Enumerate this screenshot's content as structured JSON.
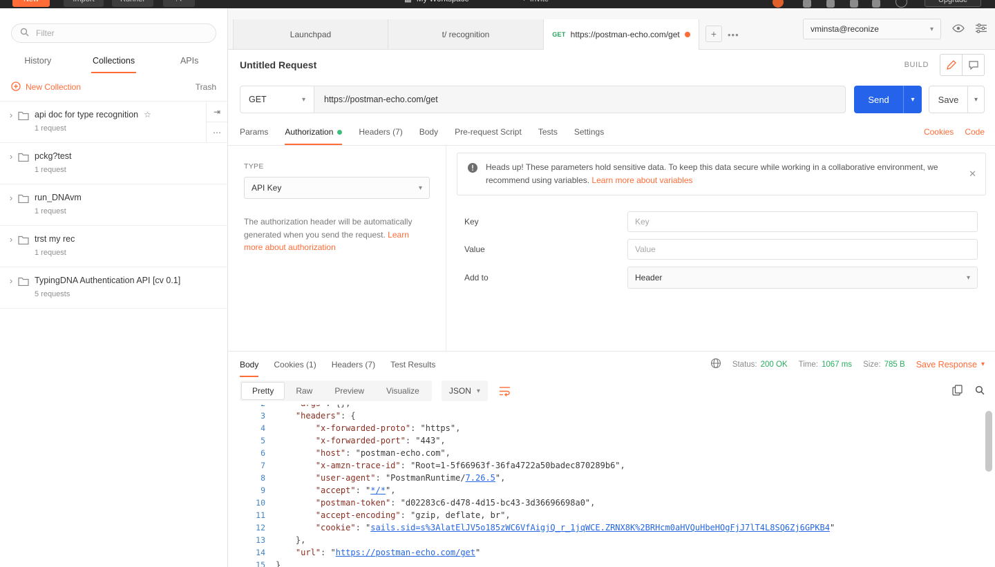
{
  "topbar": {
    "new_label": "New",
    "import_label": "Import",
    "runner_label": "Runner",
    "workspace_label": "My Workspace",
    "invite_label": "Invite",
    "upgrade_label": "Upgrade"
  },
  "sidebar": {
    "filter_placeholder": "Filter",
    "tabs": [
      {
        "label": "History",
        "active": false
      },
      {
        "label": "Collections",
        "active": true
      },
      {
        "label": "APIs",
        "active": false
      }
    ],
    "new_collection_label": "New Collection",
    "trash_label": "Trash",
    "collections": [
      {
        "name": "api doc for type recognition",
        "meta": "1 request",
        "starred": true,
        "selected": true
      },
      {
        "name": "pckg?test",
        "meta": "1 request",
        "starred": false,
        "selected": false
      },
      {
        "name": "run_DNAvm",
        "meta": "1 request",
        "starred": false,
        "selected": false
      },
      {
        "name": "trst my rec",
        "meta": "1 request",
        "starred": false,
        "selected": false
      },
      {
        "name": "TypingDNA Authentication API [cv 0.1]",
        "meta": "5 requests",
        "starred": false,
        "selected": false
      }
    ]
  },
  "tabstrip": {
    "tabs": [
      {
        "label": "Launchpad",
        "method": "",
        "active": false,
        "dirty": false
      },
      {
        "label": "t/ recognition",
        "method": "",
        "active": false,
        "dirty": false
      },
      {
        "label": "https://postman-echo.com/get",
        "method": "GET",
        "active": true,
        "dirty": true
      }
    ],
    "account": "vminsta@reconize"
  },
  "request": {
    "title": "Untitled Request",
    "build_label": "BUILD",
    "method": "GET",
    "url": "https://postman-echo.com/get",
    "send_label": "Send",
    "save_label": "Save",
    "tabs": [
      {
        "label": "Params",
        "active": false,
        "dot": false,
        "count": ""
      },
      {
        "label": "Authorization",
        "active": true,
        "dot": true,
        "count": ""
      },
      {
        "label": "Headers",
        "active": false,
        "dot": false,
        "count": "(7)"
      },
      {
        "label": "Body",
        "active": false,
        "dot": false,
        "count": ""
      },
      {
        "label": "Pre-request Script",
        "active": false,
        "dot": false,
        "count": ""
      },
      {
        "label": "Tests",
        "active": false,
        "dot": false,
        "count": ""
      },
      {
        "label": "Settings",
        "active": false,
        "dot": false,
        "count": ""
      }
    ],
    "cookies_label": "Cookies",
    "code_label": "Code"
  },
  "auth": {
    "type_label": "TYPE",
    "type_value": "API Key",
    "description": "The authorization header will be automatically generated when you send the request.",
    "learn_link": "Learn more about authorization",
    "warning_text": "Heads up! These parameters hold sensitive data. To keep this data secure while working in a collaborative environment, we recommend using variables.",
    "warning_link": "Learn more about variables",
    "key_label": "Key",
    "key_placeholder": "Key",
    "value_label": "Value",
    "value_placeholder": "Value",
    "add_to_label": "Add to",
    "add_to_value": "Header"
  },
  "response": {
    "tabs": [
      {
        "label": "Body",
        "active": true,
        "count": ""
      },
      {
        "label": "Cookies",
        "active": false,
        "count": "(1)"
      },
      {
        "label": "Headers",
        "active": false,
        "count": "(7)"
      },
      {
        "label": "Test Results",
        "active": false,
        "count": ""
      }
    ],
    "status_label": "Status:",
    "status_value": "200 OK",
    "time_label": "Time:",
    "time_value": "1067 ms",
    "size_label": "Size:",
    "size_value": "785 B",
    "save_response_label": "Save Response",
    "views": [
      {
        "label": "Pretty",
        "active": true
      },
      {
        "label": "Raw",
        "active": false
      },
      {
        "label": "Preview",
        "active": false
      },
      {
        "label": "Visualize",
        "active": false
      }
    ],
    "format": "JSON",
    "code_lines": [
      {
        "n": 2,
        "seg": [
          {
            "c": "p",
            "t": "    "
          },
          {
            "c": "k",
            "t": "\"args\""
          },
          {
            "c": "p",
            "t": ": {},"
          }
        ]
      },
      {
        "n": 3,
        "seg": [
          {
            "c": "p",
            "t": "    "
          },
          {
            "c": "k",
            "t": "\"headers\""
          },
          {
            "c": "p",
            "t": ": {"
          }
        ]
      },
      {
        "n": 4,
        "seg": [
          {
            "c": "p",
            "t": "        "
          },
          {
            "c": "k",
            "t": "\"x-forwarded-proto\""
          },
          {
            "c": "p",
            "t": ": "
          },
          {
            "c": "s",
            "t": "\"https\""
          },
          {
            "c": "p",
            "t": ","
          }
        ]
      },
      {
        "n": 5,
        "seg": [
          {
            "c": "p",
            "t": "        "
          },
          {
            "c": "k",
            "t": "\"x-forwarded-port\""
          },
          {
            "c": "p",
            "t": ": "
          },
          {
            "c": "s",
            "t": "\"443\""
          },
          {
            "c": "p",
            "t": ","
          }
        ]
      },
      {
        "n": 6,
        "seg": [
          {
            "c": "p",
            "t": "        "
          },
          {
            "c": "k",
            "t": "\"host\""
          },
          {
            "c": "p",
            "t": ": "
          },
          {
            "c": "s",
            "t": "\"postman-echo.com\""
          },
          {
            "c": "p",
            "t": ","
          }
        ]
      },
      {
        "n": 7,
        "seg": [
          {
            "c": "p",
            "t": "        "
          },
          {
            "c": "k",
            "t": "\"x-amzn-trace-id\""
          },
          {
            "c": "p",
            "t": ": "
          },
          {
            "c": "s",
            "t": "\"Root=1-5f66963f-36fa4722a50badec870289b6\""
          },
          {
            "c": "p",
            "t": ","
          }
        ]
      },
      {
        "n": 8,
        "seg": [
          {
            "c": "p",
            "t": "        "
          },
          {
            "c": "k",
            "t": "\"user-agent\""
          },
          {
            "c": "p",
            "t": ": "
          },
          {
            "c": "s",
            "t": "\"PostmanRuntime/"
          },
          {
            "c": "a",
            "t": "7.26.5"
          },
          {
            "c": "s",
            "t": "\""
          },
          {
            "c": "p",
            "t": ","
          }
        ]
      },
      {
        "n": 9,
        "seg": [
          {
            "c": "p",
            "t": "        "
          },
          {
            "c": "k",
            "t": "\"accept\""
          },
          {
            "c": "p",
            "t": ": "
          },
          {
            "c": "s",
            "t": "\""
          },
          {
            "c": "a",
            "t": "*/*"
          },
          {
            "c": "s",
            "t": "\""
          },
          {
            "c": "p",
            "t": ","
          }
        ]
      },
      {
        "n": 10,
        "seg": [
          {
            "c": "p",
            "t": "        "
          },
          {
            "c": "k",
            "t": "\"postman-token\""
          },
          {
            "c": "p",
            "t": ": "
          },
          {
            "c": "s",
            "t": "\"d02283c6-d478-4d15-bc43-3d36696698a0\""
          },
          {
            "c": "p",
            "t": ","
          }
        ]
      },
      {
        "n": 11,
        "seg": [
          {
            "c": "p",
            "t": "        "
          },
          {
            "c": "k",
            "t": "\"accept-encoding\""
          },
          {
            "c": "p",
            "t": ": "
          },
          {
            "c": "s",
            "t": "\"gzip, deflate, br\""
          },
          {
            "c": "p",
            "t": ","
          }
        ]
      },
      {
        "n": 12,
        "seg": [
          {
            "c": "p",
            "t": "        "
          },
          {
            "c": "k",
            "t": "\"cookie\""
          },
          {
            "c": "p",
            "t": ": "
          },
          {
            "c": "s",
            "t": "\""
          },
          {
            "c": "a",
            "t": "sails.sid=s%3AlatElJV5o185zWC6VfAigjQ_r_1jqWCE.ZRNX8K%2BRHcm0aHVQuHbeHOgFjJ7lT4L8SQ6Zj6GPKB4"
          },
          {
            "c": "s",
            "t": "\""
          }
        ]
      },
      {
        "n": 13,
        "seg": [
          {
            "c": "p",
            "t": "    },"
          }
        ]
      },
      {
        "n": 14,
        "seg": [
          {
            "c": "p",
            "t": "    "
          },
          {
            "c": "k",
            "t": "\"url\""
          },
          {
            "c": "p",
            "t": ": "
          },
          {
            "c": "s",
            "t": "\""
          },
          {
            "c": "a",
            "t": "https://postman-echo.com/get"
          },
          {
            "c": "s",
            "t": "\""
          }
        ]
      },
      {
        "n": 15,
        "seg": [
          {
            "c": "p",
            "t": "}"
          }
        ]
      }
    ]
  },
  "colors": {
    "accent_orange": "#FF6C37",
    "send_blue": "#2563EB",
    "success_green": "#27AE60",
    "method_get_green": "#26A65B",
    "auth_dot_green": "#3DBE7B"
  }
}
